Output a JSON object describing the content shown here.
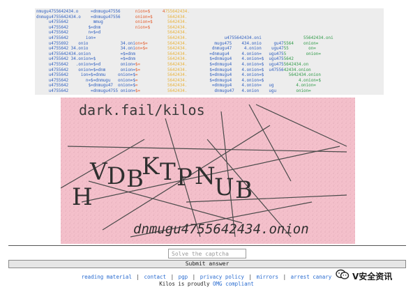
{
  "banner": {
    "lines": [
      "nmugu4755642434.o     =dnmugu47556      nion=$     4755642434.",
      "dnmugu4755642434.o    =dnmugu47556      onion=$      5642434.",
      "     u4755642          mmug             onion=$      5642434.",
      "     u4755642        $=dnm              nion=$       5642434.",
      "     u4755642        n=$=d                           5642434.",
      "     u4755642       ion=                             5642434.               u4755642434.oni                 55642434.oni",
      "     u4755692    onio             34.onion=$=        5642434.           mugu475    434.onio     gu475564    onion=",
      "     u4755642 34.onio             34.onion=$=        5642434.          dnmugu47     4.onion    ugu4755        on=",
      "     u4755642434.onion            =$=dnm             5642434.         =dnmugu4     4.onion=   ugu4755        onion=",
      "     u4755642 34.onion=$          =$=dnm             5642434.         $=dnmugu4    4.onion=$  ugu4755642",
      "     u4755642   .onion=$=d        onion=$=           5642434.         $=dnmugu4    4.onion=$  ugu4755642434.on",
      "     u4755642    onion=$=dnm      onion=$=           5642434.         $=dnmugu4    4.onion=$  u4755642434.onion",
      "     u4755642     ion=$=dnmu     onion=$=            5642434.         $=dnmugu4    4.onion=$          5642434.onion",
      "     u4755642       n=$=dnmugu   onion=$=            5642434.         $=dnmugu4    4.onion=$              4.onion=$",
      "     u4755642        $=dnmugu47  onion=$=            5642434.          =dnmugu4    4.onion=   ug         4.onion=",
      "     u4755642         =dnmugu4755 onion=$=           5642434.           dnmugu47   4.onion    ugu        onion=",
      "nmugu4755642434.o     dnmugu4755642434.onion=$=dnm   4755642434.oni        mugu4755642434.onio     ugu4755   434.onion",
      "                                                                             755642434       5642434."
    ]
  },
  "captcha": {
    "top_text": "dark.fail/kilos",
    "chars": [
      "H",
      "V",
      "D",
      "B",
      "K",
      "T",
      "P",
      "N",
      "U",
      "B"
    ],
    "bottom_text": "dnmugu4755642434.onion"
  },
  "form": {
    "input_placeholder": "Solve the captcha",
    "submit_label": "Submit answer"
  },
  "footer": {
    "links": [
      "reading material",
      "contact",
      "pgp",
      "privacy policy",
      "mirrors",
      "arrest canary"
    ],
    "separator": "|",
    "tag_prefix": "Kilos is proudly",
    "tag_link": "OMG compliant"
  },
  "watermark": {
    "text": "V安全资讯",
    "icon": "wechat-icon"
  },
  "colors": {
    "captcha_bg": "#f4c0cb",
    "link": "#2a6cd0",
    "banner_blue": "#2f5fb3",
    "banner_orange": "#e35b2a",
    "banner_yellow": "#e9b23a",
    "banner_green": "#2f9a48"
  }
}
